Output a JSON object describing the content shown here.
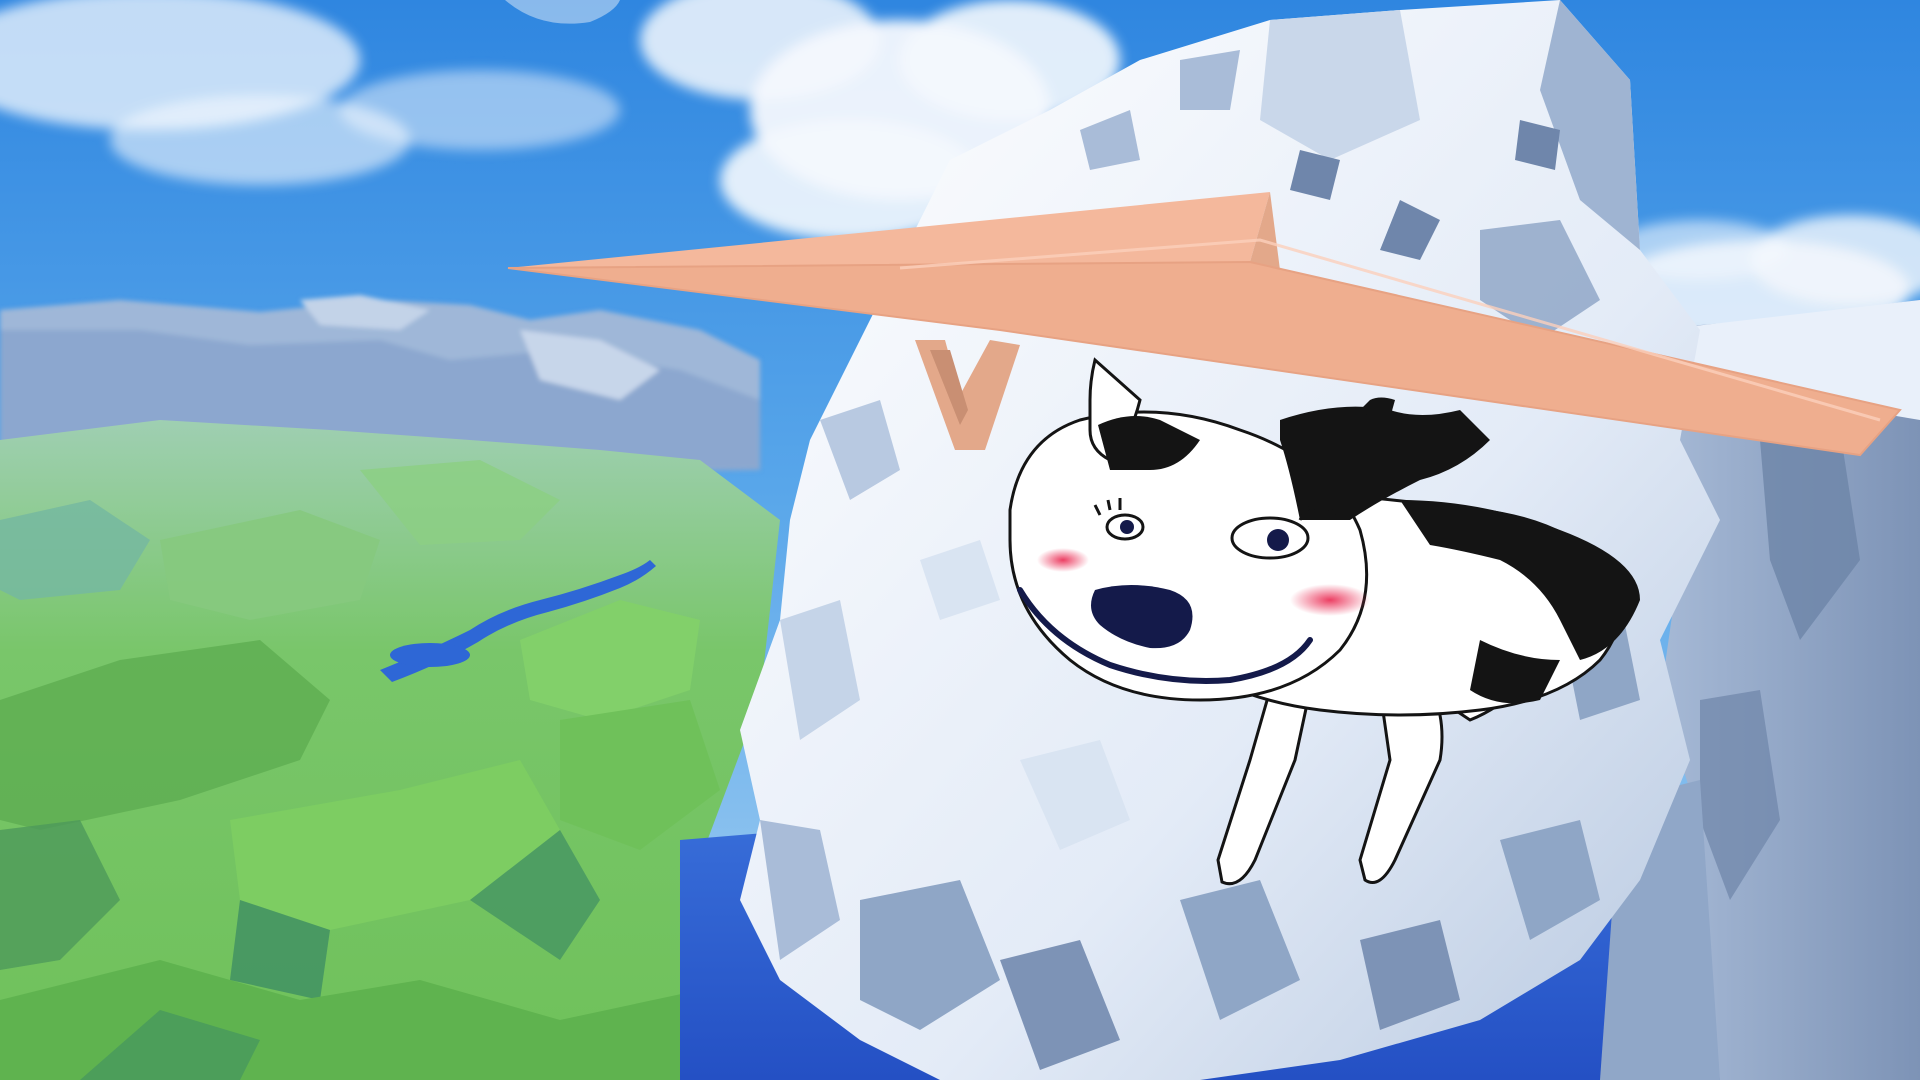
{
  "screen": {
    "type": "3d-game-scene",
    "hud_visible": false
  },
  "scene": {
    "sky_color_top": "#2f86e0",
    "sky_color_horizon": "#a9d2f2",
    "cloud_color": "#f4f8fd",
    "valley_grass_color": "#6fc15a",
    "valley_shadow_color": "#3f8f63",
    "cliff_color": "#d8e3f2",
    "cliff_shadow_color": "#8fa6c6",
    "river_color": "#2e67d6",
    "sea_color": "#2e5ed0",
    "elements": [
      "sky",
      "clouds",
      "moon",
      "distant-cliffs",
      "green-valley",
      "river",
      "snowy-rock-pillar",
      "right-cliff",
      "ocean-below"
    ]
  },
  "player": {
    "character": "cartoon-dog",
    "action": "hang-gliding",
    "glider_color": "#f4b89c",
    "glider_frame_color": "#e3a88a",
    "body_color": "#ffffff",
    "ears_color": "#141414",
    "mark_color": "#141414",
    "blush_color": "#ec3f63"
  }
}
